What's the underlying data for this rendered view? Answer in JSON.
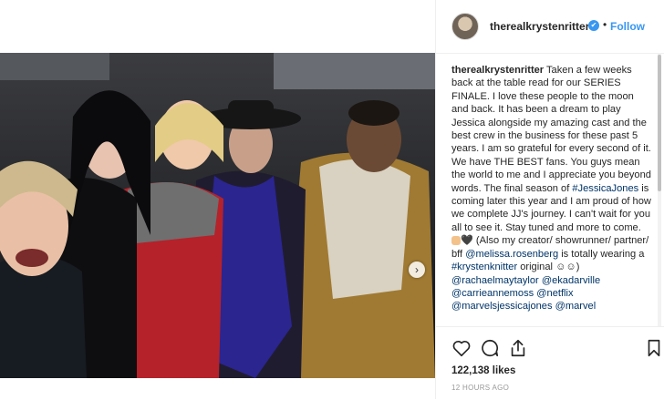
{
  "header": {
    "username": "therealkrystenritter",
    "verified_icon": "✔",
    "separator": "•",
    "follow_label": "Follow"
  },
  "photo": {
    "alt": "Group selfie of five people at a table read",
    "next_glyph": "›"
  },
  "caption": {
    "user": "therealkrystenritter",
    "text1": " Taken a few weeks back at the table read for our SERIES FINALE. I love these people to the moon and back. It has been a dream to play Jessica alongside my amazing cast and the best crew in the business for these past 5 years. I am so grateful for every second of it. We have THE BEST fans. You guys mean the world to me and I appreciate you beyond words. The final season of ",
    "tag_jessicajones": "#JessicaJones",
    "text2": " is coming later this year and I am proud of how we complete JJ's journey. I can't wait for you all to see it. Stay tuned and more to come. ",
    "emoji_heart": "🖤",
    "text3": " (Also my creator/ showrunner/ partner/ bff ",
    "mention_melissa": "@melissa.rosenberg",
    "text4": " is totally wearing a ",
    "tag_krystenknitter": "#krystenknitter",
    "text5": " original ☺☺)",
    "mention_rachael": "@rachaelmaytaylor",
    "mention_eka": "@ekadarville",
    "mention_carrie": "@carrieannemoss",
    "mention_netflix": "@netflix",
    "mention_marvelsjj": "@marvelsjessicajones",
    "mention_marvel": "@marvel"
  },
  "actions": {
    "like_icon": "heart-outline-icon",
    "comment_icon": "comment-bubble-icon",
    "share_icon": "share-icon",
    "save_icon": "bookmark-icon"
  },
  "stats": {
    "likes": "122,138 likes",
    "time_ago": "12 HOURS AGO"
  },
  "colors": {
    "accent_blue": "#3897f0",
    "link_blue": "#003569",
    "text": "#262626",
    "muted": "#999999",
    "border": "#efefef"
  }
}
